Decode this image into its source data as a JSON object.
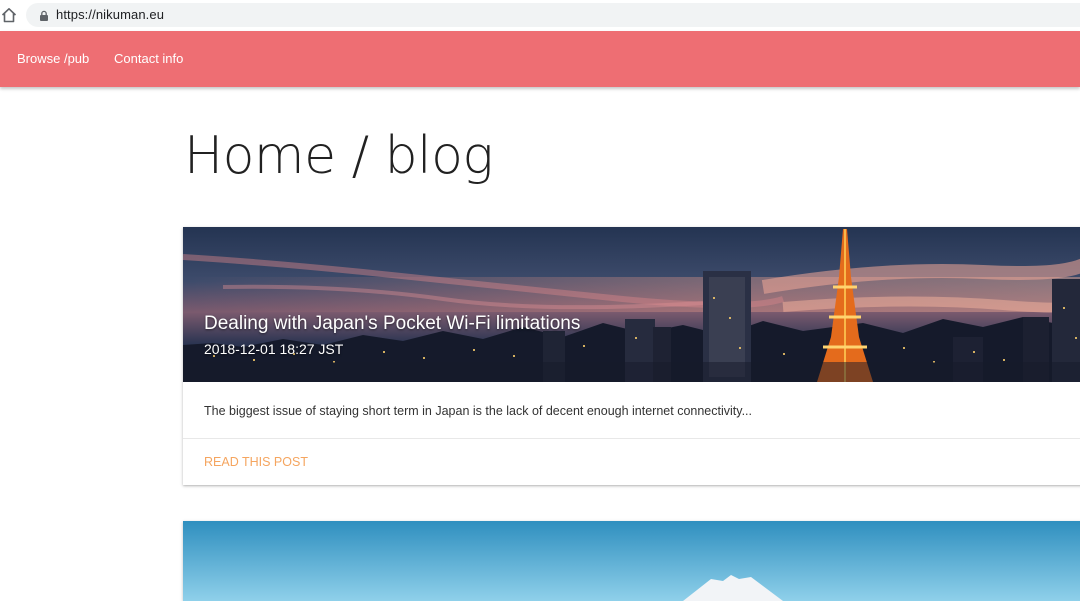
{
  "browser": {
    "url": "https://nikuman.eu"
  },
  "nav": {
    "links": [
      {
        "label": "Browse /pub"
      },
      {
        "label": "Contact info"
      }
    ]
  },
  "page": {
    "title": "Home / blog"
  },
  "posts": [
    {
      "title": "Dealing with Japan's Pocket Wi-Fi limitations",
      "date": "2018-12-01 18:27 JST",
      "excerpt": "The biggest issue of staying short term in Japan is the lack of decent enough internet connectivity...",
      "action": "READ THIS POST"
    }
  ],
  "colors": {
    "navbar": "#ee6e73",
    "action": "#f5a55f"
  }
}
